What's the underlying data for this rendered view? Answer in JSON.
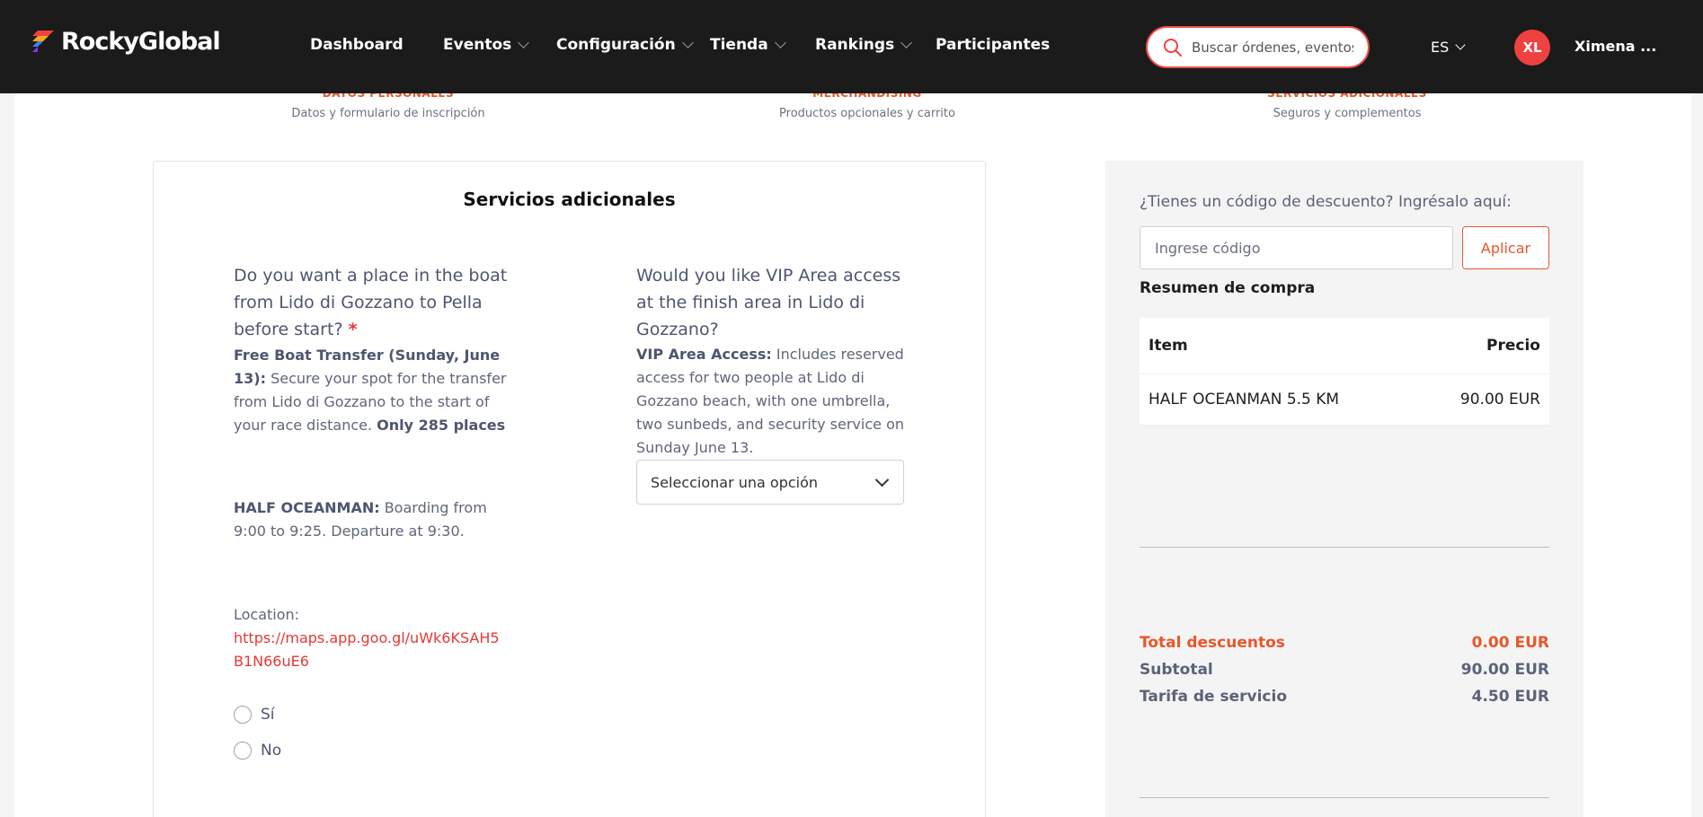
{
  "nav": {
    "brand": "RockyGlobal",
    "items": [
      "Dashboard",
      "Eventos",
      "Configuración",
      "Tienda",
      "Rankings",
      "Participantes"
    ],
    "search_placeholder": "Buscar órdenes, eventos",
    "lang": "ES",
    "avatar_initials": "XL",
    "user_name": "Ximena ..."
  },
  "steps": [
    {
      "title": "DATOS PERSONALES",
      "subtitle": "Datos y formulario de inscripción"
    },
    {
      "title": "MERCHANDISING",
      "subtitle": "Productos opcionales y carrito"
    },
    {
      "title": "SERVICIOS ADICIONALES",
      "subtitle": "Seguros y complementos"
    }
  ],
  "form": {
    "title": "Servicios adicionales",
    "q1": {
      "title": "Do you want a place in the boat from Lido di Gozzano to Pella before start?",
      "required_mark": "*",
      "p1_bold": "Free Boat Transfer (Sunday, June 13):",
      "p1_text": " Secure your spot for the transfer from Lido di Gozzano to the start of your race distance. ",
      "p1_bold2": "Only 285 places",
      "p2_bold": "HALF OCEANMAN:",
      "p2_text": " Boarding from 9:00 to 9:25. Departure at 9:30.",
      "location_label": "Location:",
      "location_link": "https://maps.app.goo.gl/uWk6KSAH5B1N66uE6",
      "options": [
        "Sí",
        "No"
      ]
    },
    "q2": {
      "title": "Would you like VIP Area access at the finish area in Lido di Gozzano?",
      "p_bold": "VIP Area Access:",
      "p_text": " Includes reserved access for two people at Lido di Gozzano beach, with one umbrella, two sunbeds, and security service on Sunday June 13.",
      "select_value": "Seleccionar una opción"
    }
  },
  "summary": {
    "discount_label": "¿Tienes un código de descuento? Ingrésalo aquí:",
    "discount_placeholder": "Ingrese código",
    "apply_label": "Aplicar",
    "title": "Resumen de compra",
    "col_item": "Item",
    "col_price": "Precio",
    "items": [
      {
        "name": "HALF OCEANMAN 5.5 KM",
        "price": "90.00 EUR"
      }
    ],
    "totals": {
      "discounts_label": "Total descuentos",
      "discounts_value": "0.00 EUR",
      "subtotal_label": "Subtotal",
      "subtotal_value": "90.00 EUR",
      "fee_label": "Tarifa de servicio",
      "fee_value": "4.50 EUR"
    }
  },
  "colors": {
    "accent": "#e8572b",
    "danger": "#f04141",
    "nav_bg": "#1b1b1b"
  }
}
